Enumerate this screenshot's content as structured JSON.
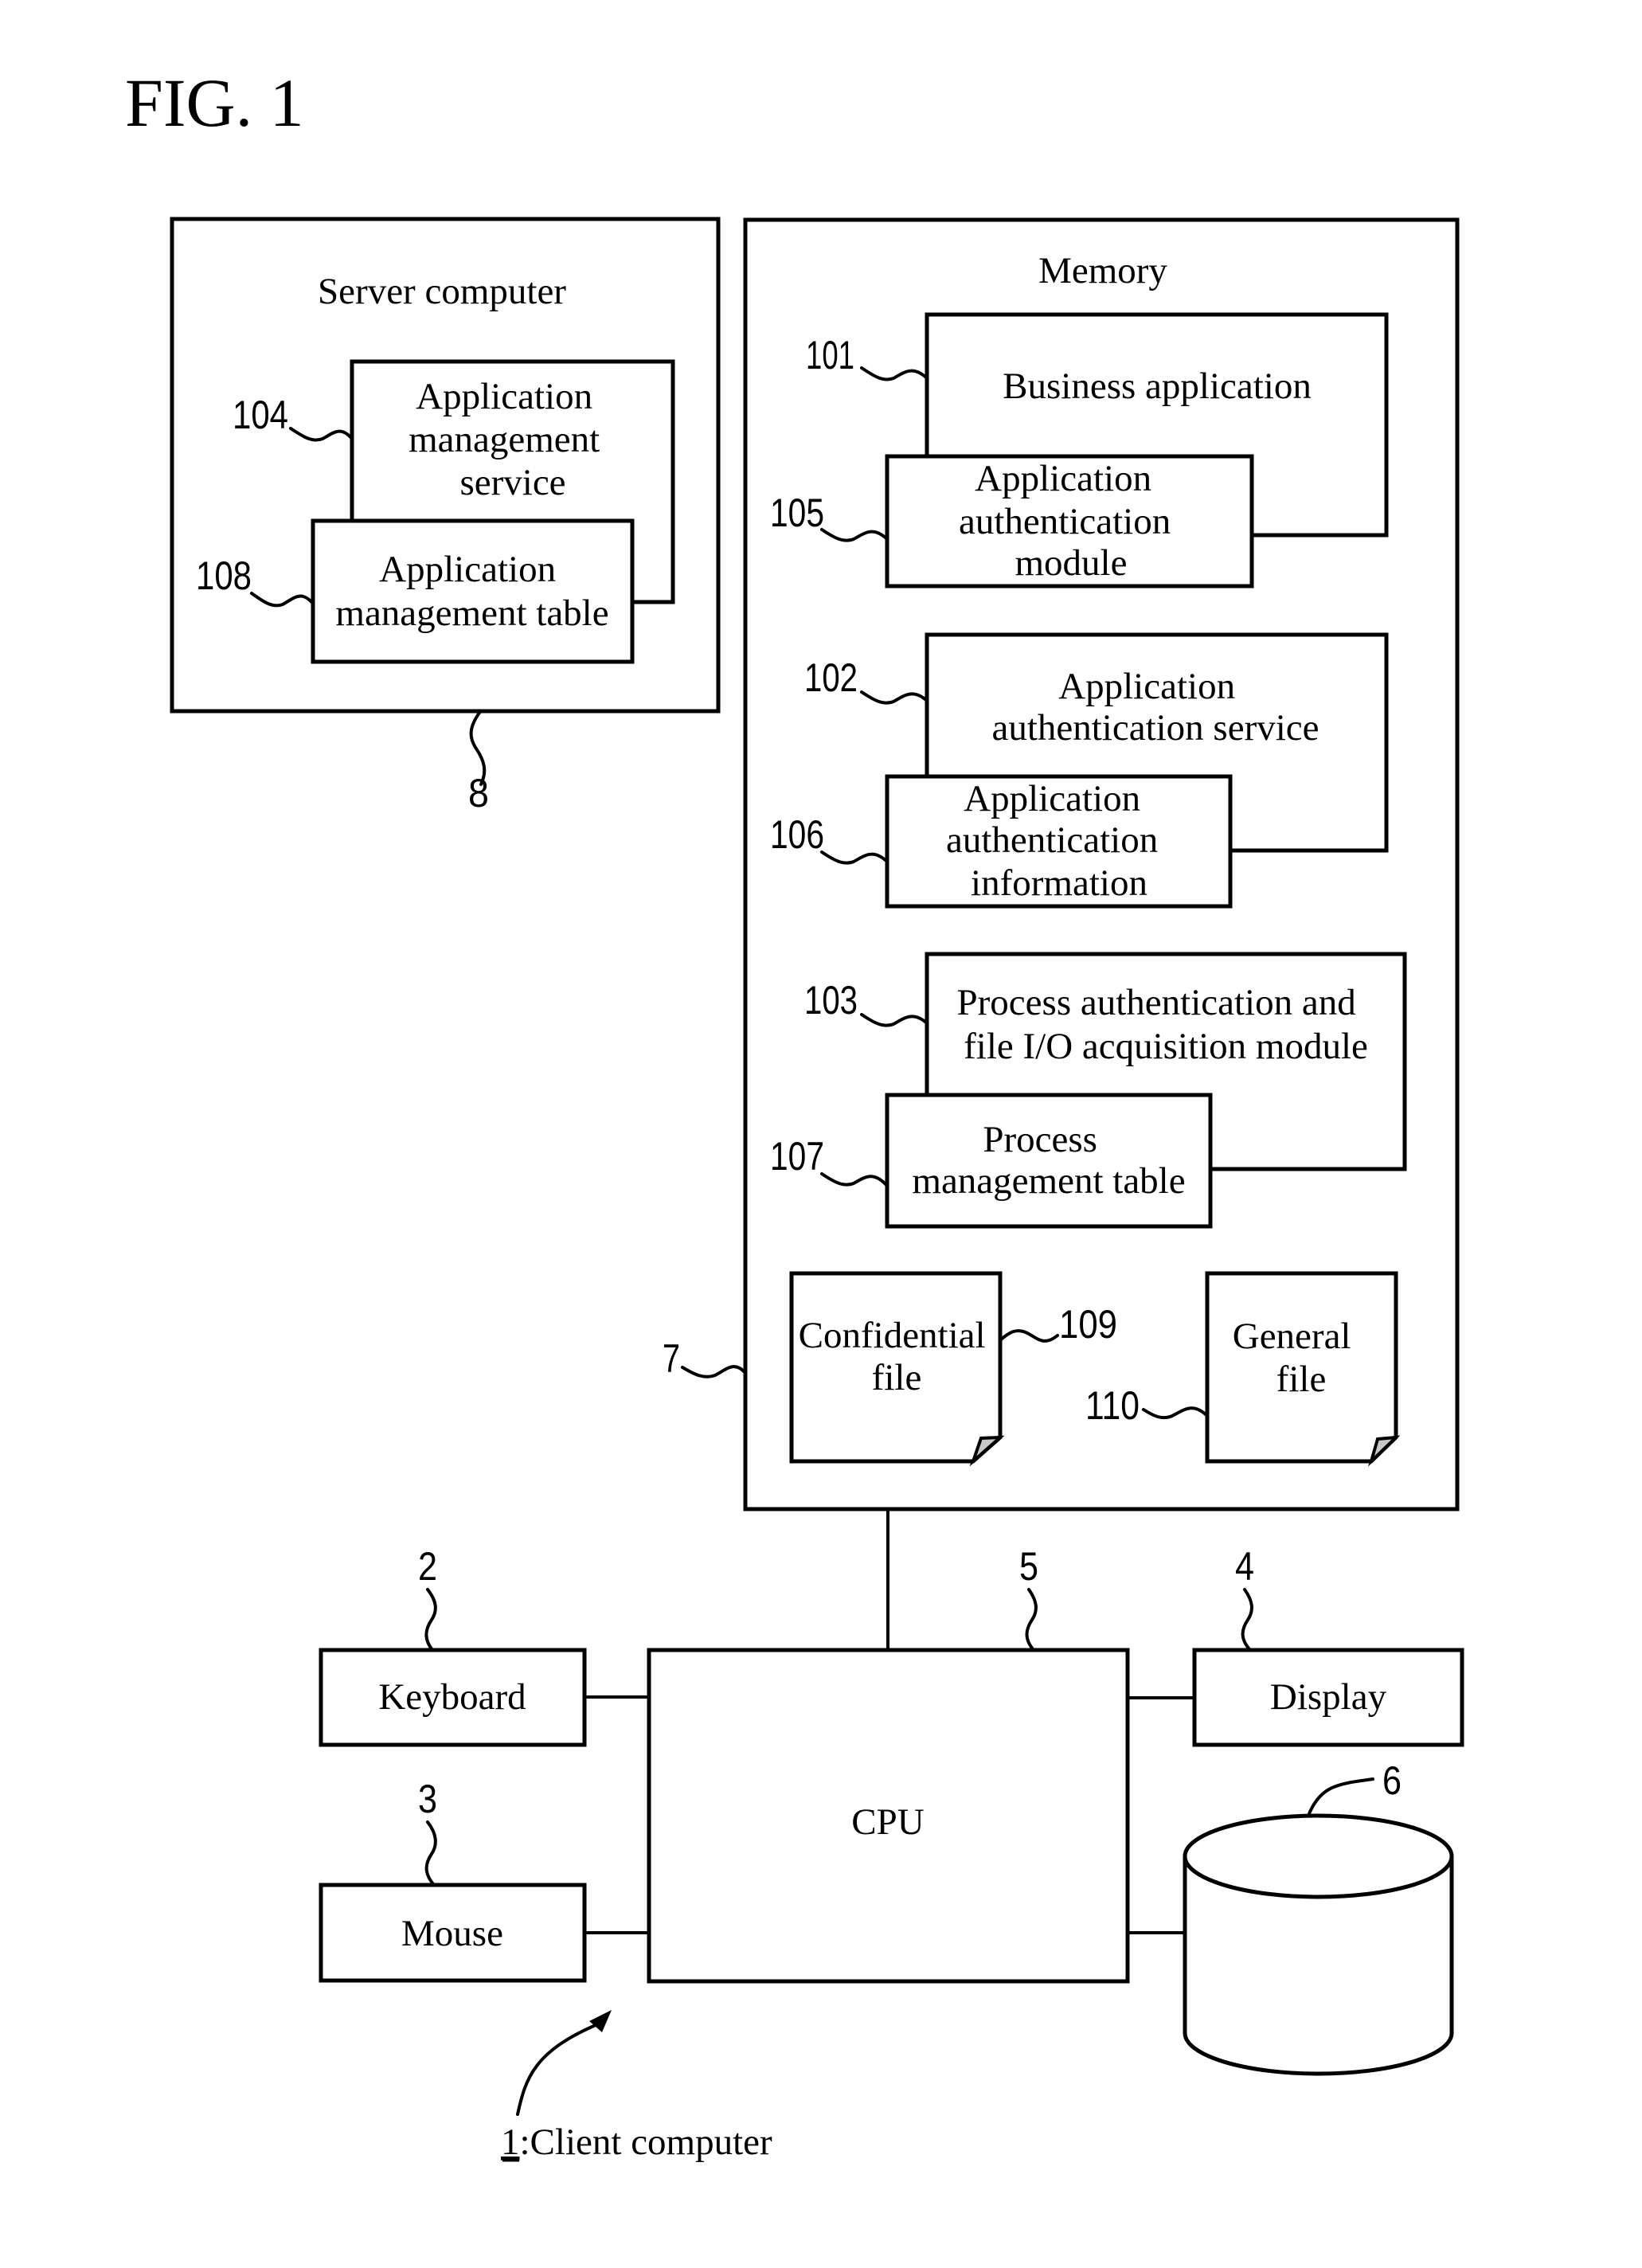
{
  "figure": {
    "title": "FIG. 1"
  },
  "server": {
    "title": "Server computer",
    "ref": "8",
    "components": {
      "management_service": {
        "ref": "104",
        "lines": [
          "Application",
          "management",
          "service"
        ]
      },
      "management_table": {
        "ref": "108",
        "lines": [
          "Application",
          "management table"
        ]
      }
    }
  },
  "memory": {
    "title": "Memory",
    "ref": "7",
    "components": {
      "business_application": {
        "ref": "101",
        "lines": [
          "Business application"
        ]
      },
      "auth_module": {
        "ref": "105",
        "lines": [
          "Application",
          "authentication",
          "module"
        ]
      },
      "auth_service": {
        "ref": "102",
        "lines": [
          "Application",
          "authentication service"
        ]
      },
      "auth_information": {
        "ref": "106",
        "lines": [
          "Application",
          "authentication",
          "information"
        ]
      },
      "process_module": {
        "ref": "103",
        "lines": [
          "Process authentication and",
          "file I/O acquisition module"
        ]
      },
      "process_table": {
        "ref": "107",
        "lines": [
          "Process",
          "management table"
        ]
      },
      "confidential_file": {
        "ref": "109",
        "lines": [
          "Confidential",
          "file"
        ]
      },
      "general_file": {
        "ref": "110",
        "lines": [
          "General",
          "file"
        ]
      }
    }
  },
  "client": {
    "ref_number": "1",
    "ref_label": ":Client computer",
    "keyboard": {
      "ref": "2",
      "label": "Keyboard"
    },
    "mouse": {
      "ref": "3",
      "label": "Mouse"
    },
    "display": {
      "ref": "4",
      "label": "Display"
    },
    "cpu": {
      "ref": "5",
      "label": "CPU"
    },
    "storage": {
      "ref": "6",
      "label": ""
    }
  }
}
